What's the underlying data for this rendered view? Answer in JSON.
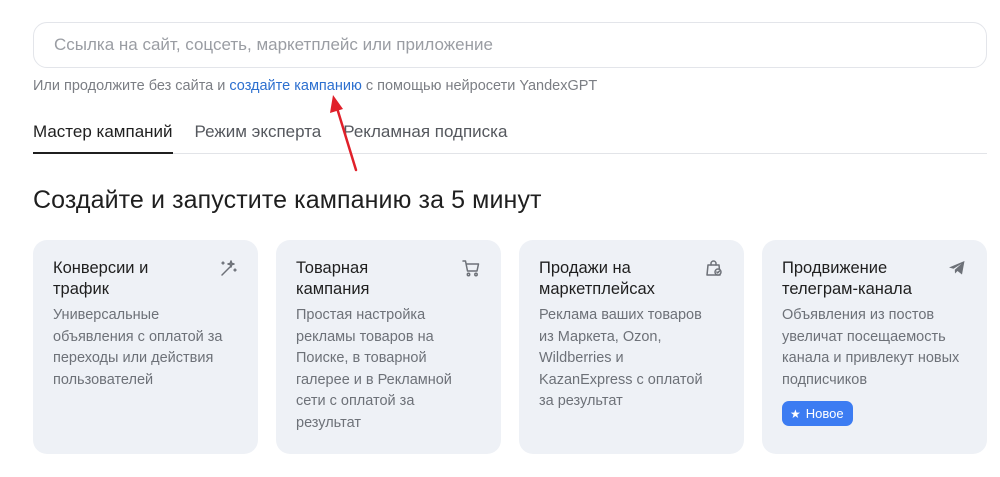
{
  "search": {
    "placeholder": "Ссылка на сайт, соцсеть, маркетплейс или приложение"
  },
  "hint": {
    "prefix": "Или продолжите без сайта и ",
    "link": "создайте кампанию",
    "suffix": " с помощью нейросети YandexGPT"
  },
  "tabs": [
    {
      "label": "Мастер кампаний",
      "active": true
    },
    {
      "label": "Режим эксперта",
      "active": false
    },
    {
      "label": "Рекламная подписка",
      "active": false
    }
  ],
  "heading": "Создайте и запустите кампанию за 5 минут",
  "cards": [
    {
      "title": "Конверсии и трафик",
      "description": "Универсальные объявления с оплатой за переходы или действия пользователей",
      "icon": "magic-wand-icon"
    },
    {
      "title": "Товарная кампания",
      "description": "Простая настройка рекламы товаров на Поиске, в товарной галерее и в Рекламной сети с оплатой за результат",
      "icon": "cart-icon"
    },
    {
      "title": "Продажи на маркетплейсах",
      "description": "Реклама ваших товаров из Маркета, Ozon, Wildberries и KazanExpress с оплатой за результат",
      "icon": "shopping-bag-icon"
    },
    {
      "title": "Продвижение телеграм-канала",
      "description": "Объявления из постов увеличат посещаемость канала и привлекут новых подписчиков",
      "icon": "telegram-icon",
      "badge": "Новое"
    }
  ],
  "colors": {
    "link": "#2c6fcf",
    "card_bg": "#eef1f6",
    "badge_bg": "#3c7cf2",
    "annotation_arrow": "#e0202a"
  }
}
